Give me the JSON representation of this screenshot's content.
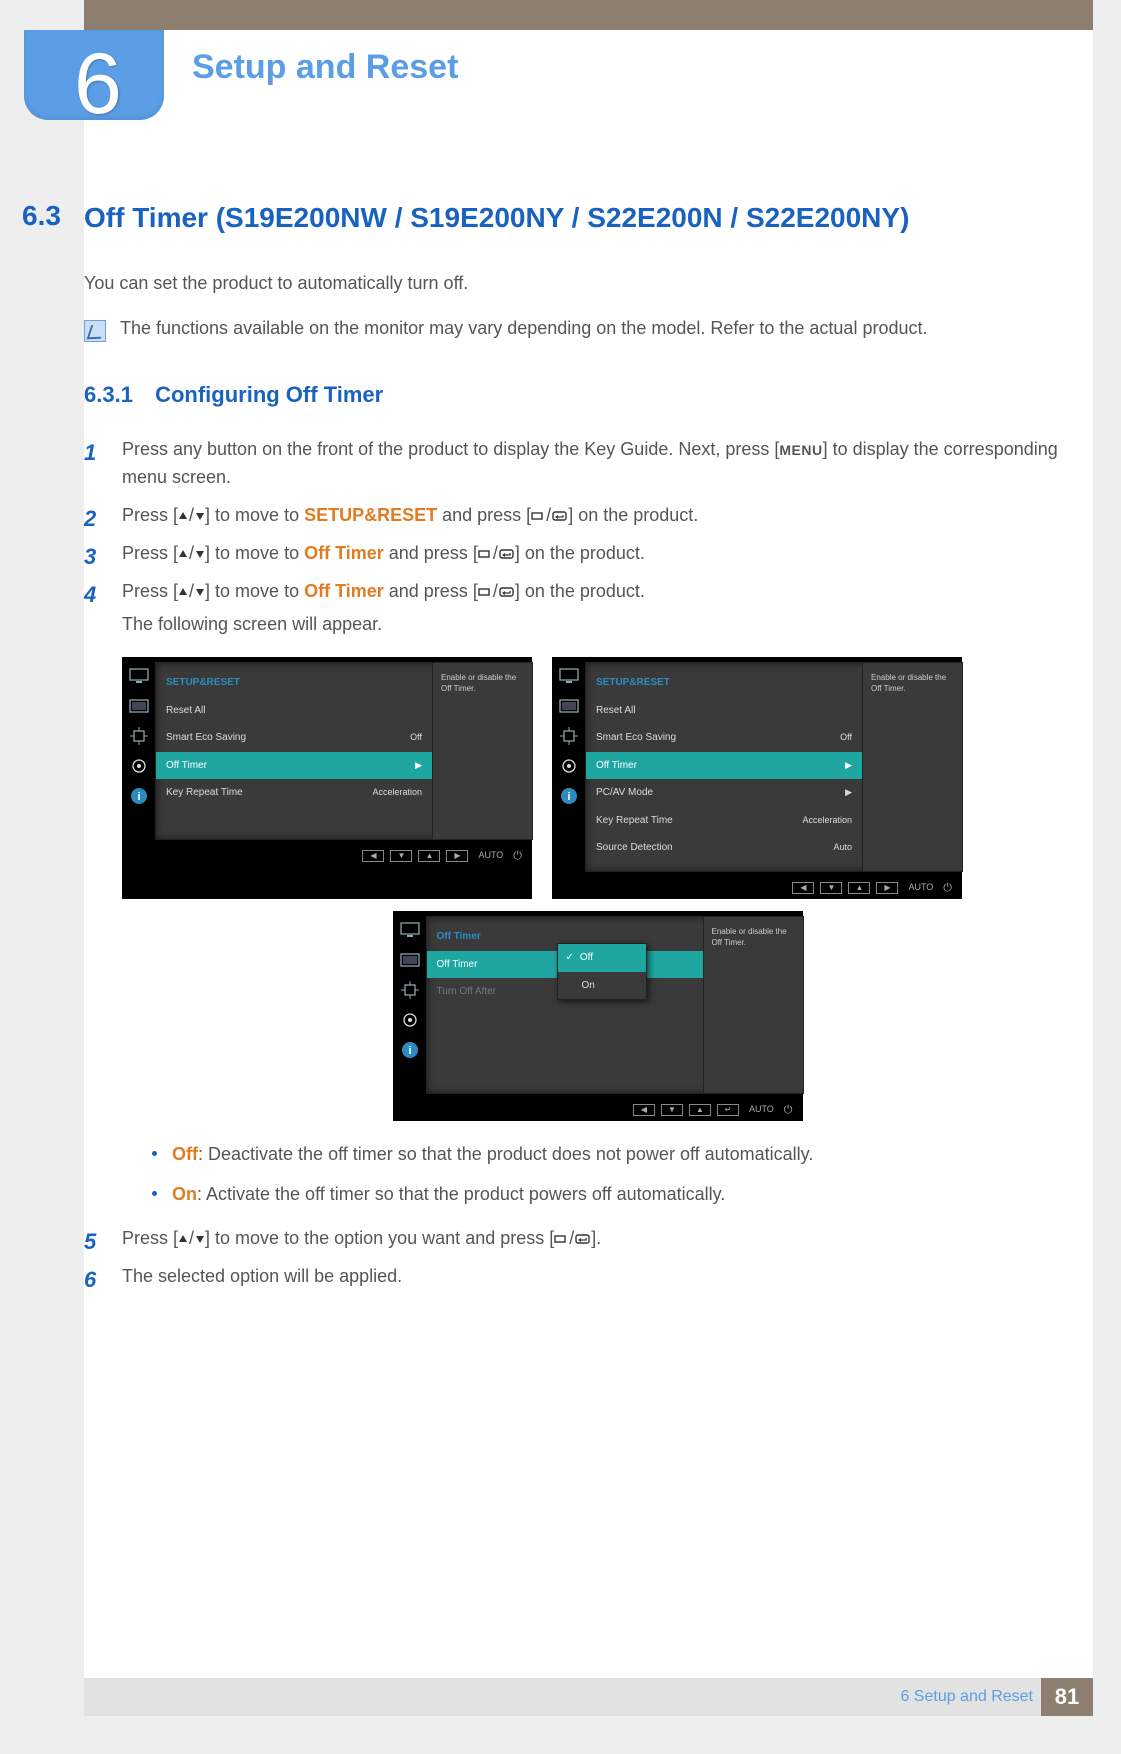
{
  "chapter": {
    "number": "6",
    "title": "Setup and Reset"
  },
  "section": {
    "number": "6.3",
    "title": "Off Timer (S19E200NW / S19E200NY / S22E200N / S22E200NY)",
    "intro": "You can set the product to automatically turn off.",
    "note": "The functions available on the monitor may vary depending on the model. Refer to the actual product."
  },
  "subsection": {
    "number": "6.3.1",
    "title": "Configuring Off Timer"
  },
  "steps": {
    "s1a": "Press any button on the front of the product to display the Key Guide. Next, press [",
    "s1menu": "MENU",
    "s1b": "] to display the corresponding menu screen.",
    "s2a": "Press [",
    "s2b": "] to move to ",
    "s2kw": "SETUP&RESET",
    "s2c": " and press [",
    "s2d": "] on the product.",
    "s3a": "Press [",
    "s3b": "] to move to ",
    "s3kw": "Off Timer",
    "s3c": " and press [",
    "s3d": "] on the product.",
    "s4a": "Press [",
    "s4b": "] to move to ",
    "s4kw": "Off Timer",
    "s4c": " and press [",
    "s4d": "] on the product.",
    "s4followup": "The following screen will appear.",
    "s5a": "Press [",
    "s5b": "] to move to the option you want and press [",
    "s5c": "].",
    "s6": "The selected option will be applied."
  },
  "bullets": {
    "off_kw": "Off",
    "off_text": ": Deactivate the off timer so that the product does not power off automatically.",
    "on_kw": "On",
    "on_text": ": Activate the off timer so that the product powers off automatically."
  },
  "osd1": {
    "title": "SETUP&RESET",
    "rows": [
      {
        "label": "Reset All",
        "value": ""
      },
      {
        "label": "Smart Eco Saving",
        "value": "Off"
      },
      {
        "label": "Off Timer",
        "value": "▶",
        "sel": true
      },
      {
        "label": "Key Repeat Time",
        "value": "Acceleration"
      }
    ],
    "help": "Enable or disable the Off Timer."
  },
  "osd2": {
    "title": "SETUP&RESET",
    "rows": [
      {
        "label": "Reset All",
        "value": ""
      },
      {
        "label": "Smart Eco Saving",
        "value": "Off"
      },
      {
        "label": "Off Timer",
        "value": "▶",
        "sel": true
      },
      {
        "label": "PC/AV Mode",
        "value": "▶"
      },
      {
        "label": "Key Repeat Time",
        "value": "Acceleration"
      },
      {
        "label": "Source Detection",
        "value": "Auto"
      }
    ],
    "help": "Enable or disable the Off Timer."
  },
  "osd3": {
    "title": "Off Timer",
    "rows": [
      {
        "label": "Off Timer",
        "value": "",
        "sel": true
      },
      {
        "label": "Turn Off After",
        "value": "",
        "dim": true
      }
    ],
    "popup": [
      {
        "label": "Off",
        "sel": true,
        "check": true
      },
      {
        "label": "On"
      }
    ],
    "help": "Enable or disable the Off Timer."
  },
  "footer_buttons": {
    "auto": "AUTO"
  },
  "footer": {
    "text": "6 Setup and Reset",
    "page": "81"
  }
}
